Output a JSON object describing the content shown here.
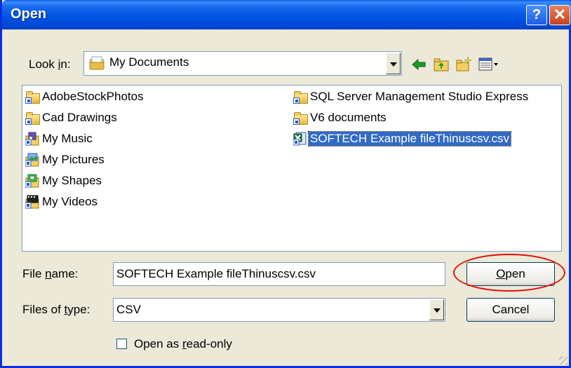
{
  "window": {
    "title": "Open",
    "help_glyph": "?",
    "close_glyph": "✕"
  },
  "lookin": {
    "label_pre": "Look ",
    "label_accel": "i",
    "label_post": "n:",
    "value": "My Documents"
  },
  "toolbar": {
    "back_icon": "back-arrow-icon",
    "up_icon": "up-folder-icon",
    "new_folder_icon": "new-folder-icon",
    "views_icon": "views-menu-icon"
  },
  "files": {
    "left_column": [
      {
        "label": "AdobeStockPhotos",
        "icon": "shared-folder-icon"
      },
      {
        "label": "Cad Drawings",
        "icon": "shared-folder-icon"
      },
      {
        "label": "My Music",
        "icon": "music-folder-icon"
      },
      {
        "label": "My Pictures",
        "icon": "pictures-folder-icon"
      },
      {
        "label": "My Shapes",
        "icon": "shapes-folder-icon"
      },
      {
        "label": "My Videos",
        "icon": "videos-folder-icon"
      }
    ],
    "right_column": [
      {
        "label": "SQL Server Management Studio Express",
        "icon": "shared-folder-icon"
      },
      {
        "label": "V6 documents",
        "icon": "shared-folder-icon"
      },
      {
        "label": "SOFTECH Example fileThinuscsv.csv",
        "icon": "csv-file-icon",
        "selected": true
      }
    ]
  },
  "filename": {
    "label_pre": "File ",
    "label_accel": "n",
    "label_post": "ame:",
    "value": "SOFTECH Example fileThinuscsv.csv"
  },
  "filetype": {
    "label_pre": "Files of ",
    "label_accel": "t",
    "label_post": "ype:",
    "value": "CSV"
  },
  "buttons": {
    "open_accel": "O",
    "open_rest": "pen",
    "cancel": "Cancel"
  },
  "readonly": {
    "label_pre": "Open as ",
    "label_accel": "r",
    "label_post": "ead-only",
    "checked": false
  },
  "colors": {
    "titlebar": "#0054e3",
    "dialog_bg": "#ece9d8",
    "selection": "#316ac5",
    "annotation": "#e01010"
  }
}
